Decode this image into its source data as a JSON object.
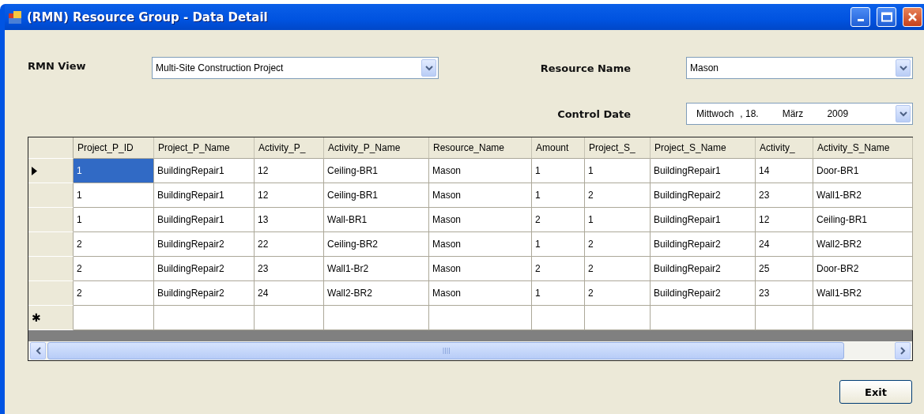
{
  "window": {
    "title": "(RMN) Resource Group - Data Detail"
  },
  "filters": {
    "rmn_view_label": "RMN View",
    "rmn_view_value": "Multi-Site Construction Project",
    "resource_name_label": "Resource Name",
    "resource_name_value": "Mason",
    "control_date_label": "Control Date",
    "control_date_parts": [
      "Mittwoch",
      ", 18.",
      "März",
      "2009"
    ]
  },
  "table": {
    "columns": [
      "Project_P_ID",
      "Project_P_Name",
      "Activity_P_",
      "Activity_P_Name",
      "Resource_Name",
      "Amount",
      "Project_S_",
      "Project_S_Name",
      "Activity_",
      "Activity_S_Name"
    ],
    "rows": [
      {
        "selected": true,
        "cells": [
          {
            "text": "1",
            "selected": true
          },
          {
            "text": "BuildingRepair1",
            "selected": false
          },
          {
            "text": "12",
            "selected": false
          },
          {
            "text": "Ceiling-BR1",
            "selected": false
          },
          {
            "text": "Mason",
            "selected": false
          },
          {
            "text": "1",
            "selected": false
          },
          {
            "text": "1",
            "selected": false
          },
          {
            "text": "BuildingRepair1",
            "selected": false
          },
          {
            "text": "14",
            "selected": false
          },
          {
            "text": "Door-BR1",
            "selected": false
          }
        ]
      },
      {
        "selected": false,
        "cells": [
          {
            "text": "1",
            "selected": false
          },
          {
            "text": "BuildingRepair1",
            "selected": false
          },
          {
            "text": "12",
            "selected": false
          },
          {
            "text": "Ceiling-BR1",
            "selected": false
          },
          {
            "text": "Mason",
            "selected": false
          },
          {
            "text": "1",
            "selected": false
          },
          {
            "text": "2",
            "selected": false
          },
          {
            "text": "BuildingRepair2",
            "selected": false
          },
          {
            "text": "23",
            "selected": false
          },
          {
            "text": "Wall1-BR2",
            "selected": false
          }
        ]
      },
      {
        "selected": false,
        "cells": [
          {
            "text": "1",
            "selected": false
          },
          {
            "text": "BuildingRepair1",
            "selected": false
          },
          {
            "text": "13",
            "selected": false
          },
          {
            "text": "Wall-BR1",
            "selected": false
          },
          {
            "text": "Mason",
            "selected": false
          },
          {
            "text": "2",
            "selected": false
          },
          {
            "text": "1",
            "selected": false
          },
          {
            "text": "BuildingRepair1",
            "selected": false
          },
          {
            "text": "12",
            "selected": false
          },
          {
            "text": "Ceiling-BR1",
            "selected": false
          }
        ]
      },
      {
        "selected": false,
        "cells": [
          {
            "text": "2",
            "selected": false
          },
          {
            "text": "BuildingRepair2",
            "selected": false
          },
          {
            "text": "22",
            "selected": false
          },
          {
            "text": "Ceiling-BR2",
            "selected": false
          },
          {
            "text": "Mason",
            "selected": false
          },
          {
            "text": "1",
            "selected": false
          },
          {
            "text": "2",
            "selected": false
          },
          {
            "text": "BuildingRepair2",
            "selected": false
          },
          {
            "text": "24",
            "selected": false
          },
          {
            "text": "Wall2-BR2",
            "selected": false
          }
        ]
      },
      {
        "selected": false,
        "cells": [
          {
            "text": "2",
            "selected": false
          },
          {
            "text": "BuildingRepair2",
            "selected": false
          },
          {
            "text": "23",
            "selected": false
          },
          {
            "text": "Wall1-Br2",
            "selected": false
          },
          {
            "text": "Mason",
            "selected": false
          },
          {
            "text": "2",
            "selected": false
          },
          {
            "text": "2",
            "selected": false
          },
          {
            "text": "BuildingRepair2",
            "selected": false
          },
          {
            "text": "25",
            "selected": false
          },
          {
            "text": "Door-BR2",
            "selected": false
          }
        ]
      },
      {
        "selected": false,
        "cells": [
          {
            "text": "2",
            "selected": false
          },
          {
            "text": "BuildingRepair2",
            "selected": false
          },
          {
            "text": "24",
            "selected": false
          },
          {
            "text": "Wall2-BR2",
            "selected": false
          },
          {
            "text": "Mason",
            "selected": false
          },
          {
            "text": "1",
            "selected": false
          },
          {
            "text": "2",
            "selected": false
          },
          {
            "text": "BuildingRepair2",
            "selected": false
          },
          {
            "text": "23",
            "selected": false
          },
          {
            "text": "Wall1-BR2",
            "selected": false
          }
        ]
      }
    ],
    "new_row_marker": "✱"
  },
  "buttons": [
    "Exit"
  ]
}
